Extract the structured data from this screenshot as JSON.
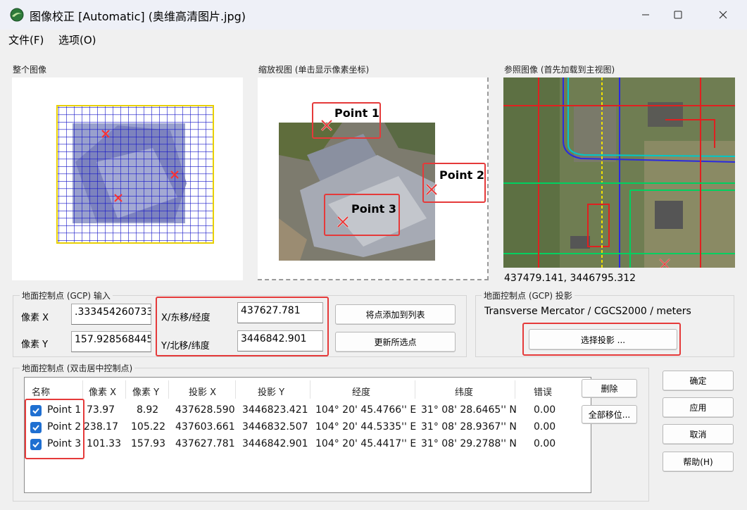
{
  "window": {
    "title": "图像校正 [Automatic] (奥维高清图片.jpg)"
  },
  "menu": {
    "items": [
      "文件(F)",
      "选项(O)"
    ]
  },
  "panels": {
    "whole_image_label": "整个图像",
    "zoom_view_label": "缩放视图 (单击显示像素坐标)",
    "reference_label": "参照图像 (首先加载到主视图)",
    "reference_coords": "437479.141, 3446795.312"
  },
  "zoom_points": [
    "Point 1",
    "Point 2",
    "Point 3"
  ],
  "gcp_input": {
    "title": "地面控制点 (GCP) 输入",
    "pixel_x_label": "像素 X",
    "pixel_x_value": ".333454260733",
    "pixel_y_label": "像素 Y",
    "pixel_y_value": "157.928568445",
    "x_label": "X/东移/经度",
    "x_value": "437627.781",
    "y_label": "Y/北移/纬度",
    "y_value": "3446842.901",
    "add_button": "将点添加到列表",
    "update_button": "更新所选点"
  },
  "projection": {
    "title": "地面控制点 (GCP) 投影",
    "value": "Transverse Mercator / CGCS2000 / meters",
    "select_button": "选择投影 ..."
  },
  "gcp_list": {
    "title": "地面控制点 (双击居中控制点)",
    "columns": [
      "名称",
      "像素 X",
      "像素 Y",
      "投影 X",
      "投影 Y",
      "经度",
      "纬度",
      "错误"
    ],
    "rows": [
      {
        "name": "Point 1",
        "px": "73.97",
        "py": "8.92",
        "projx": "437628.590",
        "projy": "3446823.421",
        "lon": "104° 20' 45.4766'' E",
        "lat": "31° 08' 28.6465'' N",
        "err": "0.00",
        "checked": true
      },
      {
        "name": "Point 2",
        "px": "238.17",
        "py": "105.22",
        "projx": "437603.661",
        "projy": "3446832.507",
        "lon": "104° 20' 44.5335'' E",
        "lat": "31° 08' 28.9367'' N",
        "err": "0.00",
        "checked": true
      },
      {
        "name": "Point 3",
        "px": "101.33",
        "py": "157.93",
        "projx": "437627.781",
        "projy": "3446842.901",
        "lon": "104° 20' 45.4417'' E",
        "lat": "31° 08' 29.2788'' N",
        "err": "0.00",
        "checked": true
      }
    ],
    "delete_button": "删除",
    "move_all_button": "全部移位..."
  },
  "dialog_buttons": {
    "ok": "确定",
    "apply": "应用",
    "cancel": "取消",
    "help": "帮助(H)"
  },
  "colors": {
    "accent": "#1f6fd1",
    "highlight_red": "#e53a3a",
    "grid_blue": "#1010c0"
  }
}
